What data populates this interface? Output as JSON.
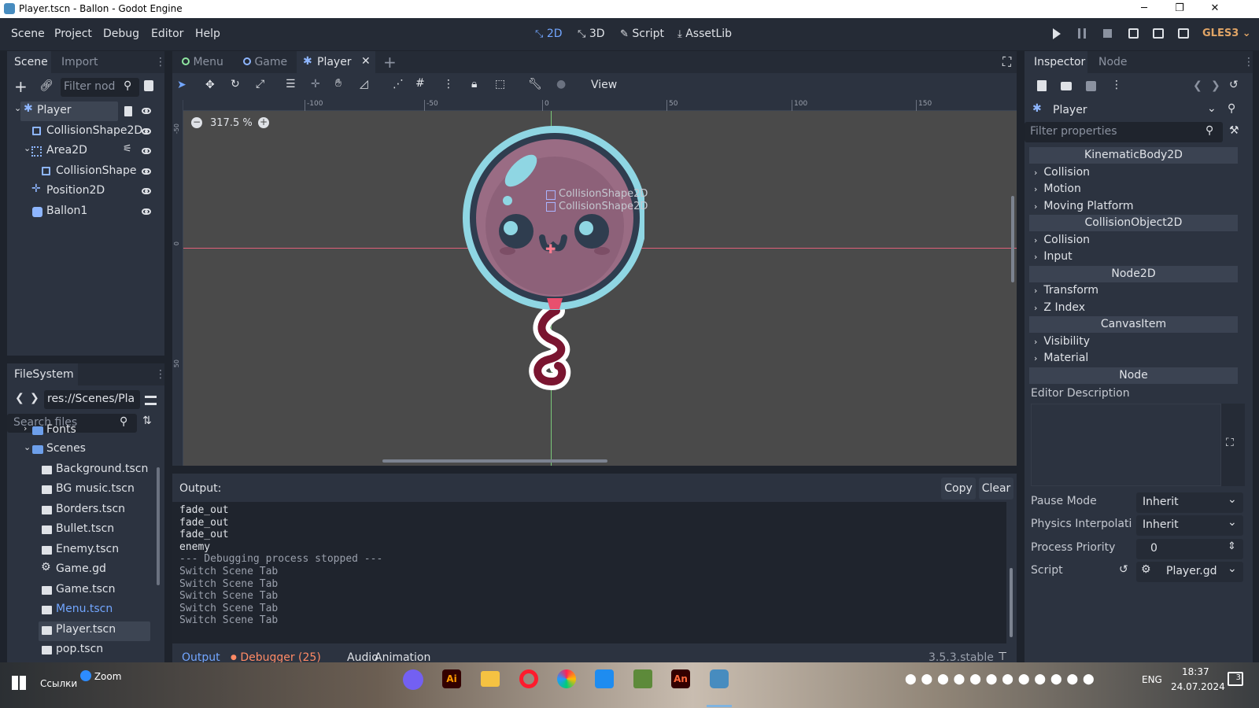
{
  "window": {
    "title": "Player.tscn - Ballon - Godot Engine",
    "min": "─",
    "max": "❐",
    "close": "✕"
  },
  "menu": [
    "Scene",
    "Project",
    "Debug",
    "Editor",
    "Help"
  ],
  "workspaces": [
    "2D",
    "3D",
    "Script",
    "AssetLib"
  ],
  "renderer": "GLES3",
  "scene_dock": {
    "tabs": [
      "Scene",
      "Import"
    ],
    "filter_placeholder": "Filter nod",
    "nodes": [
      {
        "name": "Player",
        "icon": "kinematic-icon"
      },
      {
        "name": "CollisionShape2D",
        "icon": "collision-shape-icon"
      },
      {
        "name": "Area2D",
        "icon": "area-icon"
      },
      {
        "name": "CollisionShape",
        "icon": "collision-shape-icon"
      },
      {
        "name": "Position2D",
        "icon": "position-icon"
      },
      {
        "name": "Ballon1",
        "icon": "sprite-icon"
      }
    ]
  },
  "filesystem": {
    "title": "FileSystem",
    "path": "res://Scenes/Pla",
    "search_placeholder": "Search files",
    "items": [
      "Fonts",
      "Scenes",
      "Background.tscn",
      "BG music.tscn",
      "Borders.tscn",
      "Bullet.tscn",
      "Enemy.tscn",
      "Game.gd",
      "Game.tscn",
      "Menu.tscn",
      "Player.tscn",
      "pop.tscn"
    ]
  },
  "editor_tabs": [
    "Menu",
    "Game",
    "Player"
  ],
  "toolbar": {
    "view": "View"
  },
  "viewport": {
    "zoom": "317.5 %",
    "ruler_labels": [
      "-100",
      "-50",
      "0",
      "50",
      "100",
      "150"
    ],
    "vruler_labels": [
      "-50",
      "0",
      "50"
    ],
    "shape_labels": [
      "CollisionShape2D",
      "CollisionShape2D"
    ]
  },
  "output": {
    "title": "Output:",
    "copy": "Copy",
    "clear": "Clear",
    "lines": [
      "fade_out",
      "fade_out",
      "fade_out",
      "enemy",
      "--- Debugging process stopped ---",
      "Switch Scene Tab",
      "Switch Scene Tab",
      "Switch Scene Tab",
      "Switch Scene Tab",
      "Switch Scene Tab"
    ],
    "tabs": [
      "Output",
      "Debugger (25)",
      "Audio",
      "Animation"
    ],
    "version": "3.5.3.stable"
  },
  "inspector": {
    "tabs": [
      "Inspector",
      "Node"
    ],
    "object": "Player",
    "filter_placeholder": "Filter properties",
    "sections": [
      {
        "type": "cat",
        "label": "KinematicBody2D"
      },
      {
        "type": "prop",
        "label": "Collision"
      },
      {
        "type": "prop",
        "label": "Motion"
      },
      {
        "type": "prop",
        "label": "Moving Platform"
      },
      {
        "type": "cat",
        "label": "CollisionObject2D"
      },
      {
        "type": "prop",
        "label": "Collision"
      },
      {
        "type": "prop",
        "label": "Input"
      },
      {
        "type": "cat",
        "label": "Node2D"
      },
      {
        "type": "prop",
        "label": "Transform"
      },
      {
        "type": "prop",
        "label": "Z Index"
      },
      {
        "type": "cat",
        "label": "CanvasItem"
      },
      {
        "type": "prop",
        "label": "Visibility"
      },
      {
        "type": "prop",
        "label": "Material"
      },
      {
        "type": "cat",
        "label": "Node"
      }
    ],
    "editor_description": "Editor Description",
    "props": [
      {
        "label": "Pause Mode",
        "value": "Inherit"
      },
      {
        "label": "Physics Interpolati",
        "value": "Inherit"
      },
      {
        "label": "Process Priority",
        "value": "0"
      },
      {
        "label": "Script",
        "value": "Player.gd"
      }
    ]
  },
  "taskbar": {
    "links": "Ссылки",
    "zoom": "Zoom",
    "lang": "ENG",
    "time": "18:37",
    "date": "24.07.2024",
    "notif": "3"
  },
  "colors": {
    "accent": "#72a6ff",
    "bg": "#252b36",
    "panel": "#2c3340",
    "viewport": "#4a4a4a"
  }
}
